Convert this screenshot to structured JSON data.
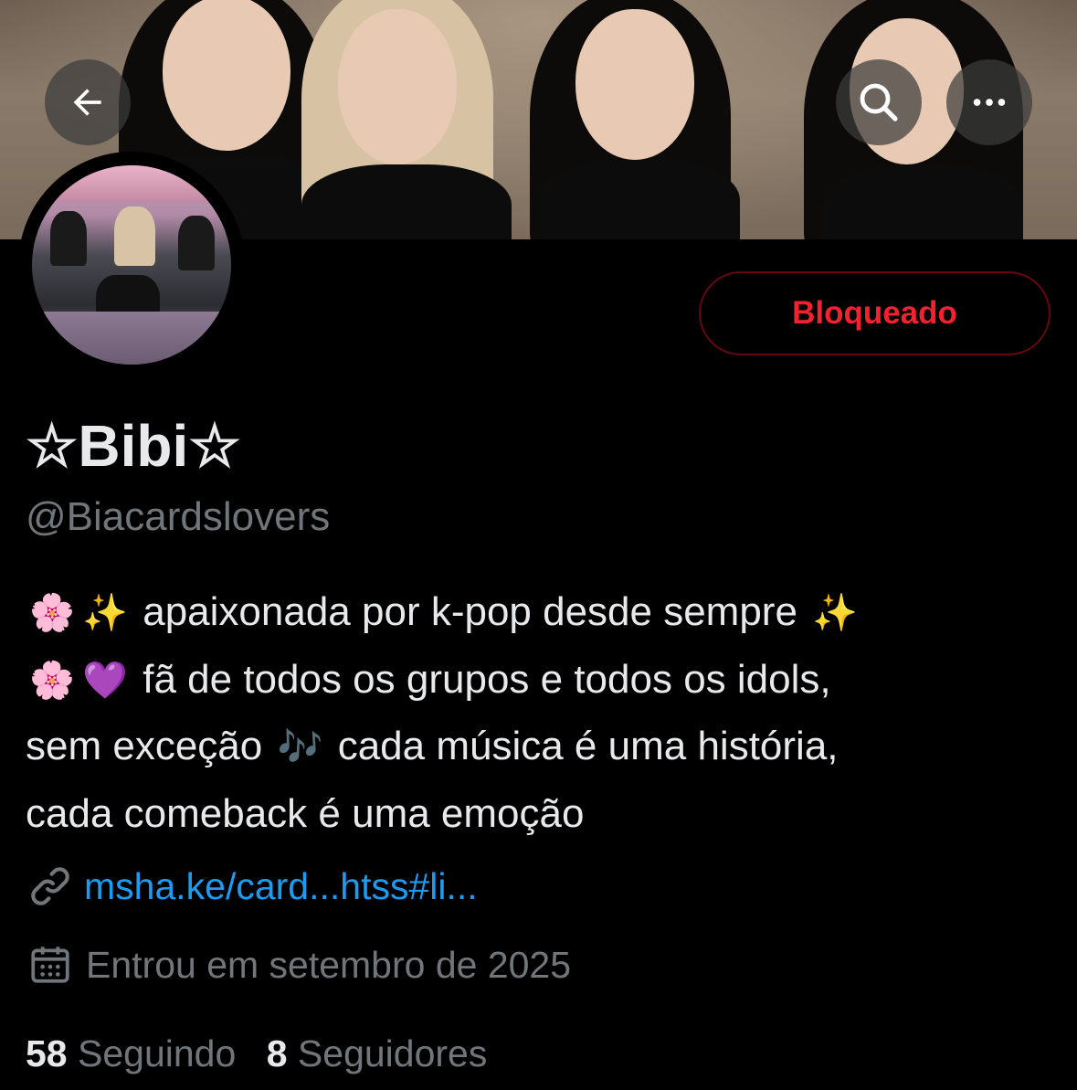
{
  "header": {
    "back_icon": "arrow-left-icon",
    "search_icon": "search-icon",
    "more_icon": "more-horizontal-icon"
  },
  "profile": {
    "display_name": "☆Bibi☆",
    "handle": "@Biacardslovers",
    "action_button": "Bloqueado",
    "action_color": "#f4212e",
    "bio": {
      "line1": {
        "emoji_a": "🌸",
        "emoji_b": "✨",
        "text": "apaixonada por k-pop desde sempre",
        "emoji_c": "✨"
      },
      "line2": {
        "emoji_a": "🌸",
        "emoji_b": "💜",
        "text": "fã de todos os grupos e todos os idols,"
      },
      "line3": {
        "text_a": "sem exceção",
        "emoji": "🎶",
        "text_b": "cada música é uma história,"
      },
      "line4": {
        "text": "cada comeback é uma emoção"
      }
    },
    "link": {
      "icon": "link-icon",
      "text": "msha.ke/card...htss#li..."
    },
    "joined": {
      "icon": "calendar-icon",
      "text": "Entrou em setembro de 2025"
    },
    "stats": {
      "following_count": "58",
      "following_label": "Seguindo",
      "followers_count": "8",
      "followers_label": "Seguidores"
    }
  },
  "colors": {
    "background": "#000000",
    "text": "#e7e9ea",
    "muted": "#71767b",
    "link": "#1d9bf0",
    "blocked": "#f4212e"
  }
}
